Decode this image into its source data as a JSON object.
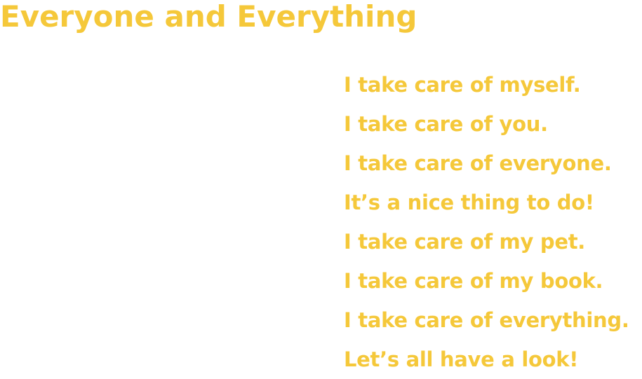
{
  "page": {
    "title": "Everyone and Everything",
    "accent_color": "#f5c83a"
  },
  "poem": {
    "lines": [
      "I take care of myself.",
      "I take care of you.",
      "I take care of everyone.",
      "It’s a nice thing to do!",
      "I take care of my pet.",
      "I take care of my book.",
      "I take care of everything.",
      "Let’s all have a look!"
    ]
  }
}
